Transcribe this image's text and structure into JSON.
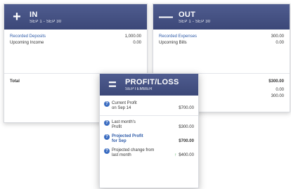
{
  "in_card": {
    "icon": "plus-icon",
    "title": "IN",
    "date_range": "SEP 1 - SEP 30",
    "rows": [
      {
        "label": "Recorded Deposits",
        "value": "1,000.00",
        "link": true
      },
      {
        "label": "Upcoming Income",
        "value": "0.00",
        "link": false
      }
    ],
    "total_label": "Total"
  },
  "out_card": {
    "icon": "minus-icon",
    "title": "OUT",
    "date_range": "SEP 1 - SEP 30",
    "rows": [
      {
        "label": "Recorded Expenses",
        "value": "300.00",
        "link": true
      },
      {
        "label": "Upcoming Bills",
        "value": "0.00",
        "link": false
      }
    ],
    "total_value": "$300.00",
    "extra_values": [
      "0.00",
      "300.00"
    ]
  },
  "profit_card": {
    "icon": "equals-icon",
    "title": "PROFIT/LOSS",
    "subtitle": "SEPTEMBER",
    "items": [
      {
        "label_line1": "Current Profit",
        "label_line2": "on Sep 14",
        "value": "$700.00",
        "emphasis": false
      },
      {
        "label_line1": "Last month's",
        "label_line2": "Profit",
        "value": "$300.00",
        "emphasis": false
      },
      {
        "label_line1": "Projected Profit",
        "label_line2": "for Sep",
        "value": "$700.00",
        "emphasis": true
      },
      {
        "label_line1": "Projected change from",
        "label_line2": "last month",
        "value": "$400.00",
        "emphasis": false,
        "trend": "up"
      }
    ]
  }
}
